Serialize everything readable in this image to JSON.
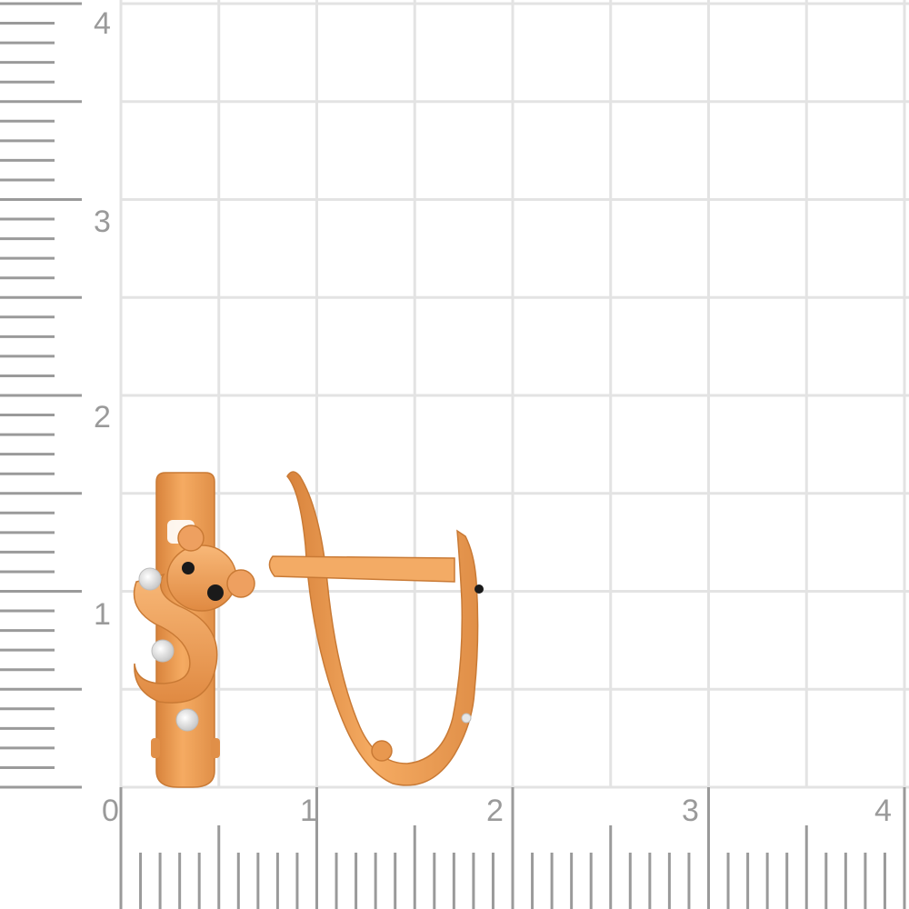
{
  "ruler": {
    "x_labels": [
      "0",
      "1",
      "2",
      "3",
      "4"
    ],
    "y_labels": [
      "1",
      "2",
      "3",
      "4"
    ]
  },
  "colors": {
    "background": "#ffffff",
    "grid": "#e3e3e3",
    "ruler": "#9a9a9a",
    "gold": "#f0a45a",
    "gold_dark": "#c97a35",
    "gold_light": "#ffc585",
    "stone": "#f2f2f2",
    "eye": "#1a1a1a"
  },
  "product": {
    "name": "earring-pair",
    "motif": "bear",
    "visible_stones": [
      "white-stone",
      "white-stone",
      "white-stone",
      "black-eye",
      "black-eye",
      "black-nose"
    ]
  }
}
